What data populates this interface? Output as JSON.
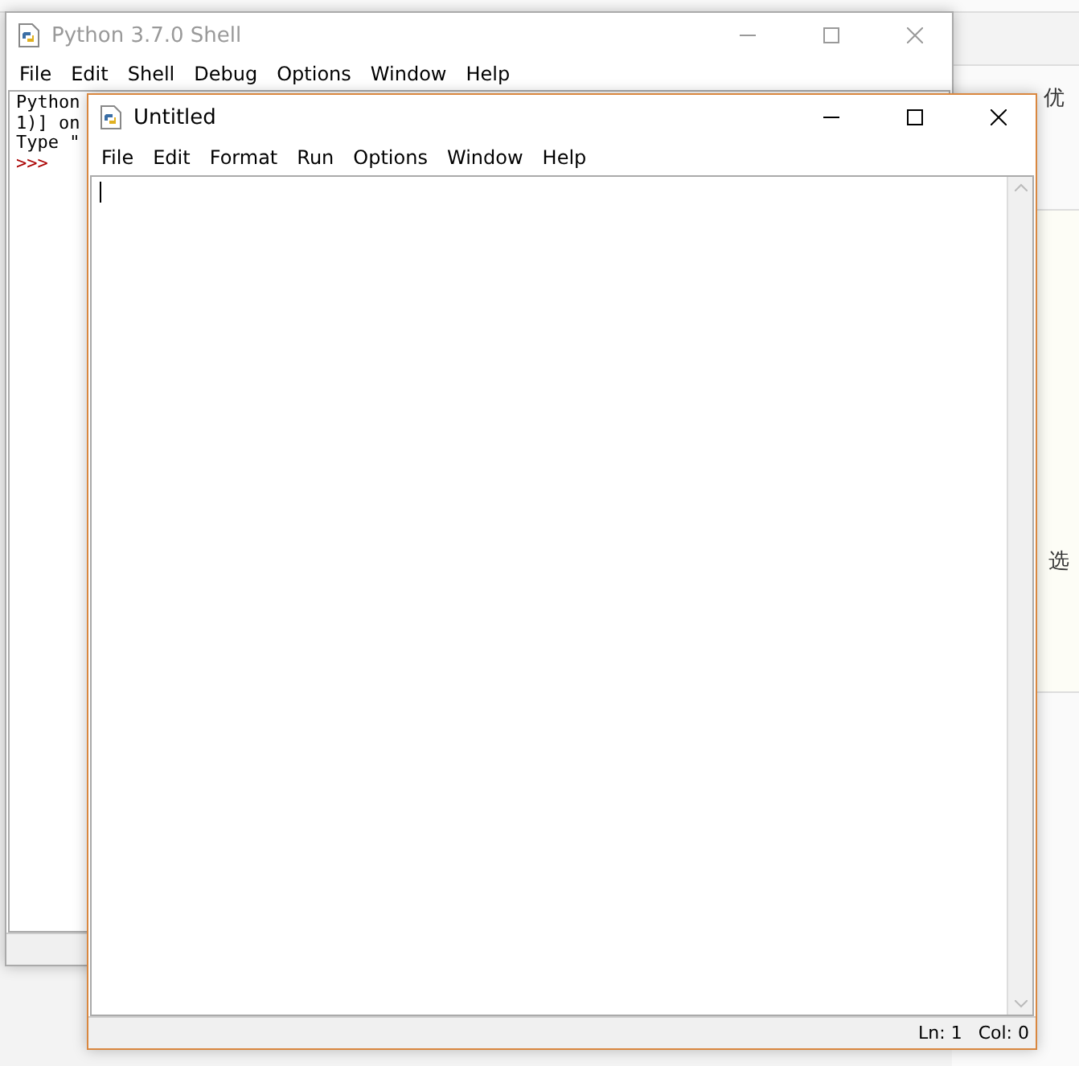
{
  "background_page": {
    "texts": [
      "优",
      "选"
    ]
  },
  "shell_window": {
    "title": "Python 3.7.0 Shell",
    "active": false,
    "menu": [
      "File",
      "Edit",
      "Shell",
      "Debug",
      "Options",
      "Window",
      "Help"
    ],
    "lines": [
      "Python",
      "1)] on",
      "Type \""
    ],
    "prompt": ">>>"
  },
  "editor_window": {
    "title": "Untitled",
    "active": true,
    "menu": [
      "File",
      "Edit",
      "Format",
      "Run",
      "Options",
      "Window",
      "Help"
    ],
    "status_bar": {
      "line": "Ln: 1",
      "column": "Col: 0"
    }
  }
}
